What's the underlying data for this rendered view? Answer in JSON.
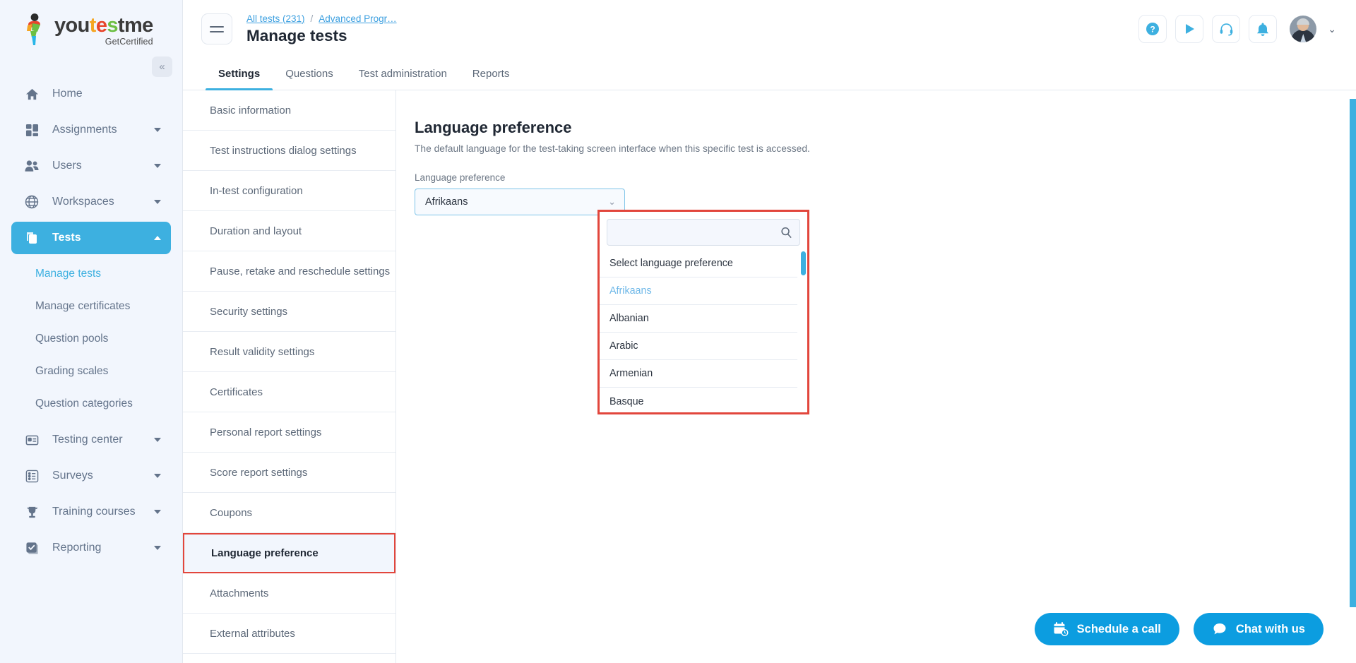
{
  "brand": {
    "word_you": "you",
    "word_t": "t",
    "word_e": "e",
    "word_s": "s",
    "word_tme": "tme",
    "tagline": "GetCertified",
    "accent_blue": "#3db0e0",
    "highlight_red": "#e2463c"
  },
  "sidebar": {
    "collapse_icon": "chevrons-left-icon",
    "items": [
      {
        "label": "Home",
        "icon": "home-icon",
        "has_caret": false,
        "active": false
      },
      {
        "label": "Assignments",
        "icon": "assignments-icon",
        "has_caret": true,
        "active": false
      },
      {
        "label": "Users",
        "icon": "users-icon",
        "has_caret": true,
        "active": false
      },
      {
        "label": "Workspaces",
        "icon": "globe-icon",
        "has_caret": true,
        "active": false
      },
      {
        "label": "Tests",
        "icon": "tests-icon",
        "has_caret": true,
        "active": true
      }
    ],
    "sub_items": [
      {
        "label": "Manage tests",
        "current": true
      },
      {
        "label": "Manage certificates",
        "current": false
      },
      {
        "label": "Question pools",
        "current": false
      },
      {
        "label": "Grading scales",
        "current": false
      },
      {
        "label": "Question categories",
        "current": false
      }
    ],
    "items_after": [
      {
        "label": "Testing center",
        "icon": "testing-center-icon",
        "has_caret": true
      },
      {
        "label": "Surveys",
        "icon": "surveys-icon",
        "has_caret": true
      },
      {
        "label": "Training courses",
        "icon": "trophy-icon",
        "has_caret": true
      },
      {
        "label": "Reporting",
        "icon": "reporting-icon",
        "has_caret": true
      }
    ]
  },
  "topbar": {
    "menu_icon": "hamburger-icon",
    "breadcrumb": {
      "root": "All tests (231)",
      "separator": "/",
      "current": "Advanced Progr…"
    },
    "page_title": "Manage tests",
    "actions": [
      {
        "name": "help-icon",
        "glyph": "?"
      },
      {
        "name": "play-icon",
        "glyph": "▶"
      },
      {
        "name": "support-headset-icon",
        "glyph": "headset"
      },
      {
        "name": "notifications-bell-icon",
        "glyph": "bell"
      }
    ],
    "avatar_name": "user-avatar",
    "chevron": "⌄"
  },
  "tabs": [
    {
      "label": "Settings",
      "active": true
    },
    {
      "label": "Questions",
      "active": false
    },
    {
      "label": "Test administration",
      "active": false
    },
    {
      "label": "Reports",
      "active": false
    }
  ],
  "settings_list": [
    {
      "label": "Basic information",
      "selected": false
    },
    {
      "label": "Test instructions dialog settings",
      "selected": false
    },
    {
      "label": "In-test configuration",
      "selected": false
    },
    {
      "label": "Duration and layout",
      "selected": false
    },
    {
      "label": "Pause, retake and reschedule settings",
      "selected": false
    },
    {
      "label": "Security settings",
      "selected": false
    },
    {
      "label": "Result validity settings",
      "selected": false
    },
    {
      "label": "Certificates",
      "selected": false
    },
    {
      "label": "Personal report settings",
      "selected": false
    },
    {
      "label": "Score report settings",
      "selected": false
    },
    {
      "label": "Coupons",
      "selected": false
    },
    {
      "label": "Language preference",
      "selected": true
    },
    {
      "label": "Attachments",
      "selected": false
    },
    {
      "label": "External attributes",
      "selected": false
    }
  ],
  "panel": {
    "title": "Language preference",
    "description": "The default language for the test-taking screen interface when this specific test is accessed.",
    "field_label": "Language preference",
    "select_value": "Afrikaans",
    "select_caret": "⌄"
  },
  "dropdown": {
    "search_value": "",
    "search_placeholder": "",
    "search_icon": "search-icon",
    "options": [
      {
        "label": "Select language preference",
        "selected": false
      },
      {
        "label": "Afrikaans",
        "selected": true
      },
      {
        "label": "Albanian",
        "selected": false
      },
      {
        "label": "Arabic",
        "selected": false
      },
      {
        "label": "Armenian",
        "selected": false
      },
      {
        "label": "Basque",
        "selected": false
      }
    ]
  },
  "bottom_actions": [
    {
      "label": "Schedule a call",
      "icon": "calendar-clock-icon"
    },
    {
      "label": "Chat with us",
      "icon": "chat-bubble-icon"
    }
  ]
}
